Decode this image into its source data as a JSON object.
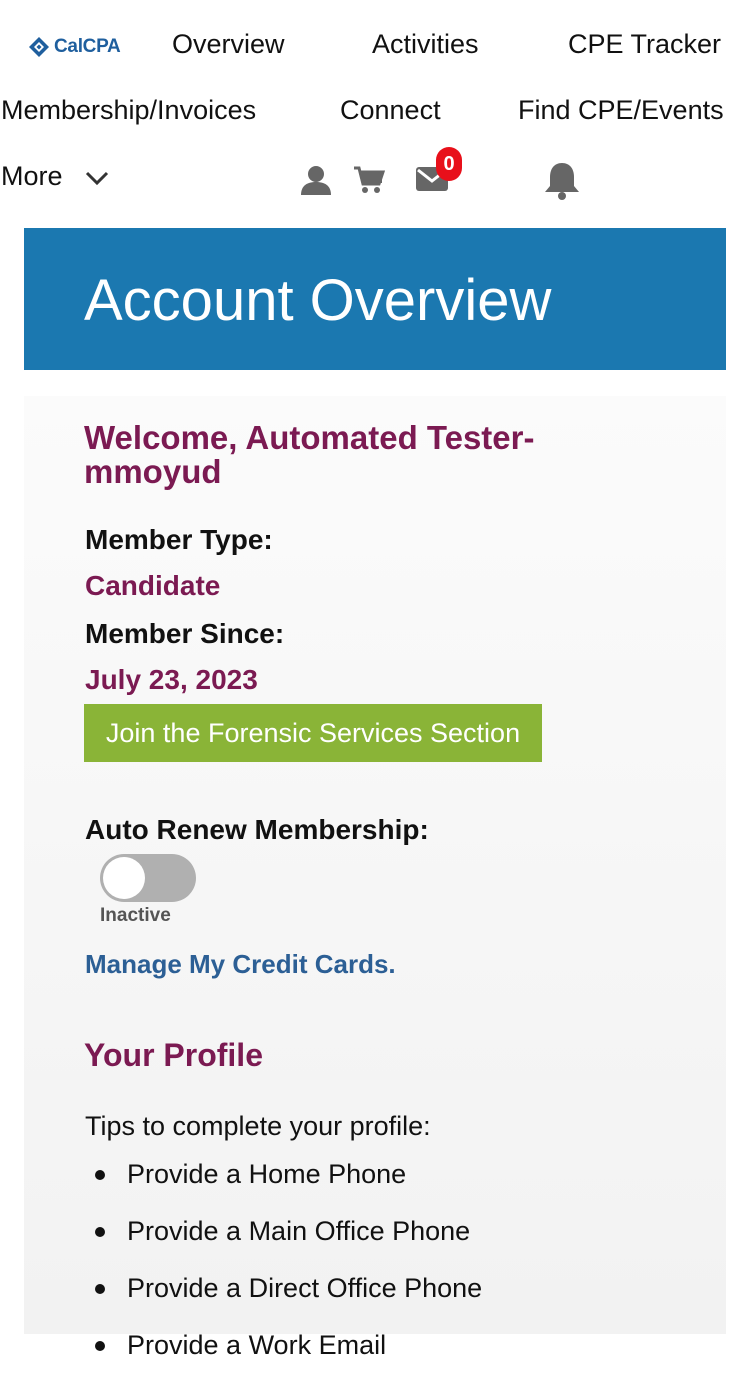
{
  "brand": {
    "logo_text": "CalCPA",
    "logo_color": "#1f5f9e"
  },
  "nav": {
    "overview": "Overview",
    "activities": "Activities",
    "cpe_tracker": "CPE Tracker",
    "membership_invoices": "Membership/Invoices",
    "connect": "Connect",
    "find_cpe_events": "Find CPE/Events",
    "more": "More"
  },
  "icons": {
    "account": "user-icon",
    "cart": "cart-icon",
    "messages": "envelope-icon",
    "notifications": "bell-icon",
    "more_chevron": "chevron-down-icon"
  },
  "messages_badge": "0",
  "banner": {
    "title": "Account Overview",
    "color": "#1b78b0"
  },
  "account": {
    "welcome_line1": "Welcome, Automated Tester-",
    "welcome_line2": "mmoyud",
    "member_type_label": "Member Type:",
    "member_type_value": "Candidate",
    "member_since_label": "Member Since:",
    "member_since_value": "July 23, 2023",
    "join_button": "Join the Forensic Services Section",
    "auto_renew_label": "Auto Renew Membership:",
    "auto_renew_status": "Inactive",
    "manage_cards_link": "Manage My Credit Cards."
  },
  "profile": {
    "heading": "Your Profile",
    "tips_intro": "Tips to complete your profile:",
    "tips": [
      "Provide a Home Phone",
      "Provide a Main Office Phone",
      "Provide a Direct Office Phone",
      "Provide a Work Email"
    ]
  },
  "colors": {
    "accent_maroon": "#7b1a52",
    "button_green": "#8ab437",
    "link_blue": "#2c5f95",
    "badge_red": "#e8101a"
  }
}
